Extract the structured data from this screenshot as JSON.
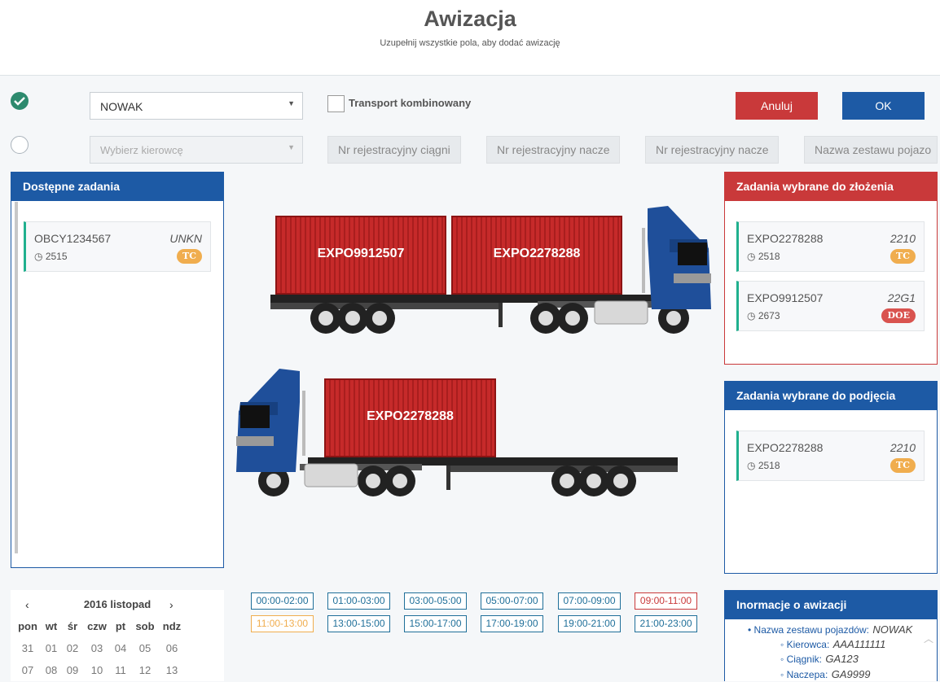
{
  "header": {
    "title": "Awizacja",
    "subtitle": "Uzupełnij wszystkie pola, aby dodać awizację"
  },
  "form": {
    "carrier_value": "NOWAK",
    "driver_placeholder": "Wybierz kierowcę",
    "combined_transport_label": "Transport kombinowany",
    "cancel_label": "Anuluj",
    "ok_label": "OK",
    "reg_tractor": "Nr rejestracyjny ciągni",
    "reg_trailer_1": "Nr rejestracyjny nacze",
    "reg_trailer_2": "Nr rejestracyjny nacze",
    "set_name": "Nazwa zestawu pojazo"
  },
  "available_panel": {
    "title": "Dostępne zadania",
    "tasks": [
      {
        "code": "OBCY1234567",
        "type": "UNKN",
        "num": "2515",
        "badge": "TC"
      }
    ]
  },
  "drop_panel": {
    "title": "Zadania wybrane do złożenia",
    "tasks": [
      {
        "code": "EXPO2278288",
        "type": "2210",
        "num": "2518",
        "badge": "TC"
      },
      {
        "code": "EXPO9912507",
        "type": "22G1",
        "num": "2673",
        "badge": "DOE"
      }
    ]
  },
  "pickup_panel": {
    "title": "Zadania wybrane do podjęcia",
    "tasks": [
      {
        "code": "EXPO2278288",
        "type": "2210",
        "num": "2518",
        "badge": "TC"
      }
    ]
  },
  "trucks": {
    "top_containers": [
      "EXPO9912507",
      "EXPO2278288"
    ],
    "bottom_containers": [
      "EXPO2278288"
    ]
  },
  "calendar": {
    "prev": "‹",
    "next": "›",
    "month": "2016 listopad",
    "day_names": [
      "pon",
      "wt",
      "śr",
      "czw",
      "pt",
      "sob",
      "ndz"
    ],
    "week1": [
      "31",
      "01",
      "02",
      "03",
      "04",
      "05",
      "06"
    ],
    "week2": [
      "07",
      "08",
      "09",
      "10",
      "11",
      "12",
      "13"
    ]
  },
  "timeslots": [
    {
      "label": "00:00-02:00",
      "state": "available"
    },
    {
      "label": "01:00-03:00",
      "state": "available"
    },
    {
      "label": "03:00-05:00",
      "state": "available"
    },
    {
      "label": "05:00-07:00",
      "state": "available"
    },
    {
      "label": "07:00-09:00",
      "state": "available"
    },
    {
      "label": "09:00-11:00",
      "state": "full"
    },
    {
      "label": "11:00-13:00",
      "state": "limited"
    },
    {
      "label": "13:00-15:00",
      "state": "available"
    },
    {
      "label": "15:00-17:00",
      "state": "available"
    },
    {
      "label": "17:00-19:00",
      "state": "available"
    },
    {
      "label": "19:00-21:00",
      "state": "available"
    },
    {
      "label": "21:00-23:00",
      "state": "available"
    }
  ],
  "info_panel": {
    "title": "Inormacje o awizacji",
    "set_label": "Nazwa zestawu pojazdów:",
    "set_value": "NOWAK",
    "driver_label": "Kierowca:",
    "driver_value": "AAA111111",
    "tractor_label": "Ciągnik:",
    "tractor_value": "GA123",
    "trailer_label": "Naczepa:",
    "trailer_value": "GA9999"
  },
  "colors": {
    "primary": "#1d5aa5",
    "danger": "#c9393a",
    "success": "#2d8a6e",
    "accent_green": "#20b08e",
    "badge_tc": "#f0ad4e",
    "badge_doe": "#d9534f",
    "container": "#c62a2a",
    "truck_cab": "#1f4f9a"
  }
}
